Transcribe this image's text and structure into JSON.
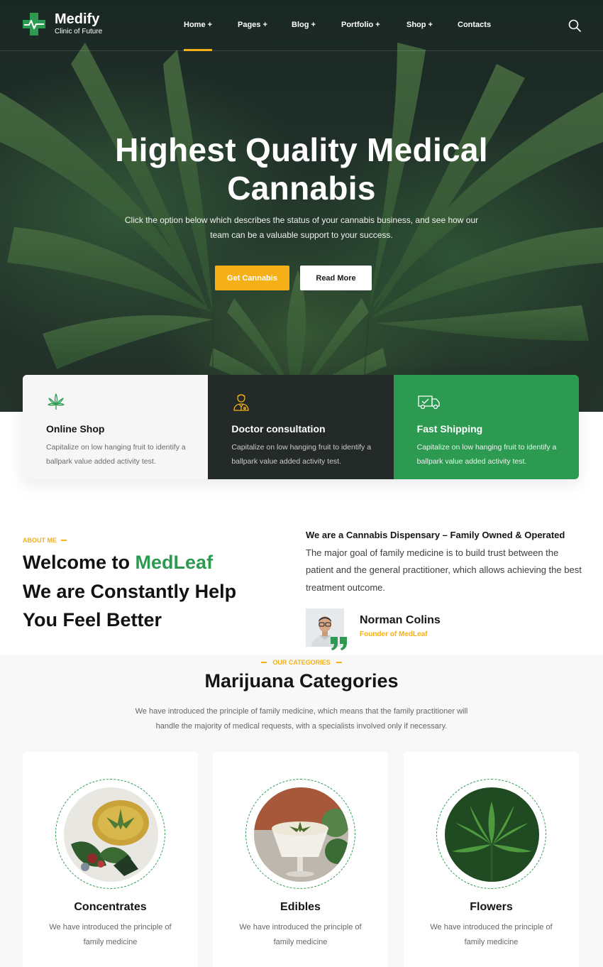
{
  "brand": {
    "name": "Medify",
    "tagline": "Clinic of Future",
    "accent": "#f4b016",
    "green": "#2c9a51"
  },
  "nav": {
    "items": [
      {
        "label": "Home +",
        "active": true
      },
      {
        "label": "Pages +"
      },
      {
        "label": "Blog +"
      },
      {
        "label": "Portfolio +"
      },
      {
        "label": "Shop +"
      },
      {
        "label": "Contacts"
      }
    ],
    "search_icon": "search-icon"
  },
  "hero": {
    "title_line1": "Highest Quality Medical",
    "title_line2": "Cannabis",
    "subtitle": "Click the option below which describes the status of your cannabis business, and see how our team can be a valuable support to your success.",
    "primary_button": "Get Cannabis",
    "secondary_button": "Read More"
  },
  "features": [
    {
      "icon": "cannabis-leaf-icon",
      "title": "Online Shop",
      "text": "Capitalize on low hanging fruit to identify a ballpark value added activity test."
    },
    {
      "icon": "doctor-icon",
      "title": "Doctor consultation",
      "text": "Capitalize on low hanging fruit to identify a ballpark value added activity test."
    },
    {
      "icon": "delivery-truck-icon",
      "title": "Fast Shipping",
      "text": "Capitalize on low hanging fruit to identify a ballpark value added activity test."
    }
  ],
  "about": {
    "eyebrow": "ABOUT ME",
    "heading_prefix": "Welcome to ",
    "heading_accent": "MedLeaf",
    "heading_line2": "We are Constantly Help",
    "heading_line3": "You Feel Better",
    "lead": "We are a Cannabis Dispensary – Family Owned & Operated",
    "body": "The major goal of family medicine is to build trust between the patient and the general practitioner, which allows achieving the best treatment outcome.",
    "author_name": "Norman Colins",
    "author_role": "Founder of MedLeaf"
  },
  "categories": {
    "eyebrow": "OUR CATEGORIES",
    "title": "Marijuana Categories",
    "subtitle": "We have introduced the principle of family medicine, which means that the family practitioner will handle the majority of medical requests, with a specialists involved only if necessary.",
    "items": [
      {
        "name": "Concentrates",
        "desc": "We have introduced the principle of family medicine"
      },
      {
        "name": "Edibles",
        "desc": "We have introduced the principle of family medicine"
      },
      {
        "name": "Flowers",
        "desc": "We have introduced the principle of family medicine"
      }
    ]
  }
}
